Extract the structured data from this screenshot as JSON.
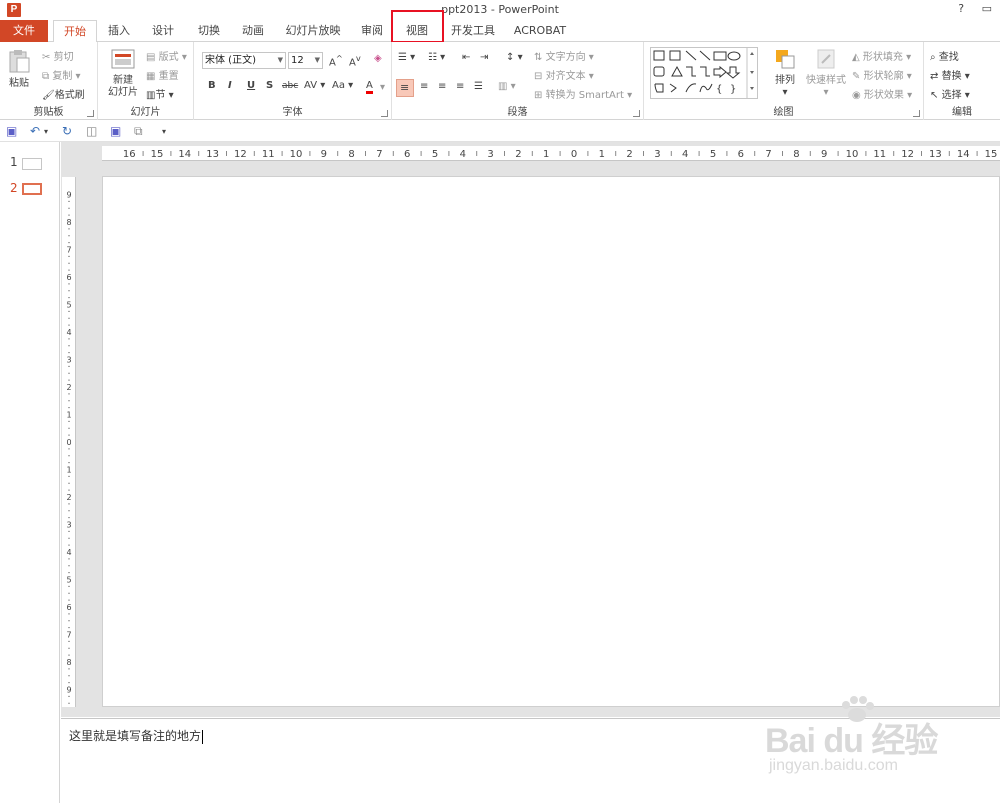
{
  "titlebar": {
    "app_icon": "P",
    "title": "ppt2013 - PowerPoint",
    "help": "?",
    "restore": "▭"
  },
  "tabs": [
    {
      "label": "文件"
    },
    {
      "label": "开始"
    },
    {
      "label": "插入"
    },
    {
      "label": "设计"
    },
    {
      "label": "切换"
    },
    {
      "label": "动画"
    },
    {
      "label": "幻灯片放映"
    },
    {
      "label": "审阅"
    },
    {
      "label": "视图"
    },
    {
      "label": "开发工具"
    },
    {
      "label": "ACROBAT"
    }
  ],
  "ribbon": {
    "clipboard": {
      "label": "剪贴板",
      "paste": "粘贴",
      "cut": "剪切",
      "copy": "复制",
      "format_painter": "格式刷"
    },
    "slides": {
      "label": "幻灯片",
      "new_slide_1": "新建",
      "new_slide_2": "幻灯片",
      "layout": "版式",
      "reset": "重置",
      "section": "节"
    },
    "font": {
      "label": "字体",
      "font_name": "宋体 (正文)",
      "font_size": "12",
      "bold": "B",
      "italic": "I",
      "underline": "U",
      "shadow": "S",
      "strike": "abc",
      "spacing": "AV",
      "case": "Aa",
      "color": "A"
    },
    "paragraph": {
      "label": "段落",
      "text_direction": "文字方向",
      "align_text": "对齐文本",
      "smartart": "转换为 SmartArt"
    },
    "drawing": {
      "label": "绘图",
      "arrange": "排列",
      "quick_styles": "快速样式",
      "shape_fill": "形状填充",
      "shape_outline": "形状轮廓",
      "shape_effects": "形状效果"
    },
    "editing": {
      "label": "编辑",
      "find": "查找",
      "replace": "替换",
      "select": "选择"
    }
  },
  "slides_panel": [
    {
      "number": "1"
    },
    {
      "number": "2"
    }
  ],
  "notes": {
    "text": "这里就是填写备注的地方"
  },
  "watermark": {
    "brand": "Bai  du 经验",
    "url": "jingyan.baidu.com"
  },
  "colors": {
    "accent": "#d24726",
    "highlight": "#e81123"
  }
}
